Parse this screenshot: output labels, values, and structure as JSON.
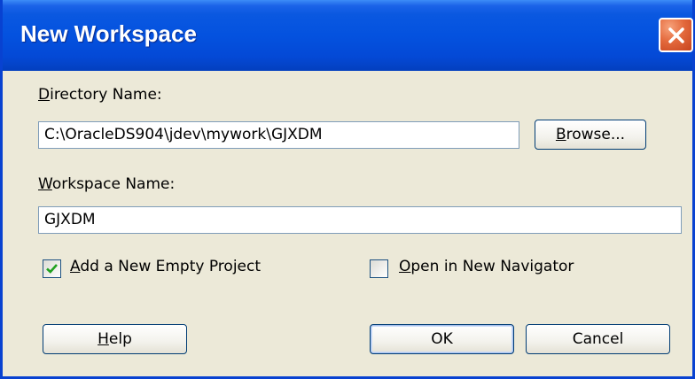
{
  "window": {
    "title": "New Workspace"
  },
  "directory": {
    "label_prefix": "",
    "label_mnemonic": "D",
    "label_rest": "irectory Name:",
    "value": "C:\\OracleDS904\\jdev\\mywork\\GJXDM",
    "browse_mnemonic": "B",
    "browse_rest": "rowse..."
  },
  "workspace": {
    "label_mnemonic": "W",
    "label_rest": "orkspace Name:",
    "value": "GJXDM"
  },
  "options": {
    "add_project": {
      "checked": true,
      "label_mnemonic": "A",
      "label_rest": "dd a New Empty Project"
    },
    "open_navigator": {
      "checked": false,
      "label_mnemonic": "O",
      "label_rest": "pen in New Navigator"
    }
  },
  "buttons": {
    "help_mnemonic": "H",
    "help_rest": "elp",
    "ok": "OK",
    "cancel": "Cancel"
  },
  "colors": {
    "titlebar": "#0452df",
    "dialog_bg": "#ece9d8",
    "close_button": "#e46a3d",
    "check_mark": "#21a121"
  },
  "icons": {
    "close": "close-icon",
    "check": "checkmark-icon"
  }
}
